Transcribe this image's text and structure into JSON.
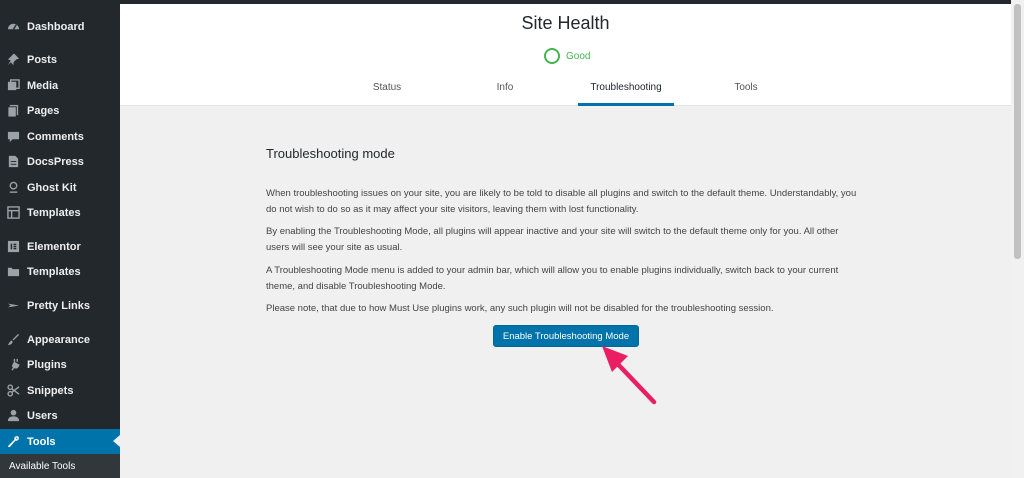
{
  "sidebar": {
    "items": [
      {
        "label": "Dashboard",
        "icon": "dashboard-icon"
      },
      {
        "label": "Posts",
        "icon": "pin-icon"
      },
      {
        "label": "Media",
        "icon": "media-icon"
      },
      {
        "label": "Pages",
        "icon": "pages-icon"
      },
      {
        "label": "Comments",
        "icon": "comment-icon"
      },
      {
        "label": "DocsPress",
        "icon": "document-icon"
      },
      {
        "label": "Ghost Kit",
        "icon": "ghost-icon"
      },
      {
        "label": "Templates",
        "icon": "layout-icon"
      },
      {
        "label": "Elementor",
        "icon": "elementor-icon"
      },
      {
        "label": "Templates",
        "icon": "folder-icon"
      },
      {
        "label": "Pretty Links",
        "icon": "star-icon"
      },
      {
        "label": "Appearance",
        "icon": "brush-icon"
      },
      {
        "label": "Plugins",
        "icon": "plug-icon"
      },
      {
        "label": "Snippets",
        "icon": "scissors-icon"
      },
      {
        "label": "Users",
        "icon": "user-icon"
      },
      {
        "label": "Tools",
        "icon": "wrench-icon"
      }
    ],
    "active": "Tools",
    "submenu_label": "Available Tools"
  },
  "header": {
    "title": "Site Health",
    "status": "Good",
    "status_color": "#46b450",
    "tabs": [
      {
        "label": "Status"
      },
      {
        "label": "Info"
      },
      {
        "label": "Troubleshooting"
      },
      {
        "label": "Tools"
      }
    ],
    "active_tab": "Troubleshooting"
  },
  "main": {
    "section_title": "Troubleshooting mode",
    "paragraphs": [
      "When troubleshooting issues on your site, you are likely to be told to disable all plugins and switch to the default theme. Understandably, you do not wish to do so as it may affect your site visitors, leaving them with lost functionality.",
      "By enabling the Troubleshooting Mode, all plugins will appear inactive and your site will switch to the default theme only for you. All other users will see your site as usual.",
      "A Troubleshooting Mode menu is added to your admin bar, which will allow you to enable plugins individually, switch back to your current theme, and disable Troubleshooting Mode.",
      "Please note, that due to how Must Use plugins work, any such plugin will not be disabled for the troubleshooting session."
    ],
    "button_label": "Enable Troubleshooting Mode"
  },
  "colors": {
    "accent": "#0073aa",
    "sidebar_bg": "#23282d",
    "arrow": "#e91e63"
  }
}
